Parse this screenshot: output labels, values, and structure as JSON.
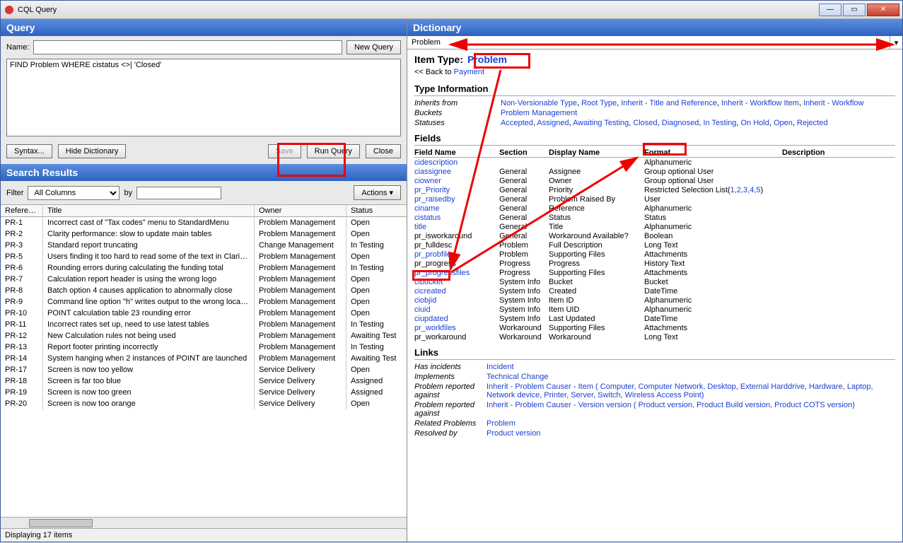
{
  "window": {
    "title": "CQL Query"
  },
  "query": {
    "header": "Query",
    "name_label": "Name:",
    "name_value": "",
    "new_query": "New Query",
    "cql_text": "FIND Problem WHERE cistatus <>| 'Closed'",
    "syntax": "Syntax...",
    "hide_dict": "Hide Dictionary",
    "save": "Save",
    "run": "Run Query",
    "close": "Close"
  },
  "results": {
    "header": "Search Results",
    "filter_label": "Filter",
    "filter_value": "All Columns",
    "by_label": "by",
    "by_value": "",
    "actions": "Actions ▾",
    "cols": {
      "ref": "Reference",
      "title": "Title",
      "owner": "Owner",
      "status": "Status"
    },
    "rows": [
      {
        "ref": "PR-1",
        "title": "Incorrect cast of \"Tax codes\" menu to StandardMenu",
        "owner": "Problem Management",
        "status": "Open"
      },
      {
        "ref": "PR-2",
        "title": "Clarity performance: slow to update main tables",
        "owner": "Problem Management",
        "status": "Open"
      },
      {
        "ref": "PR-3",
        "title": "Standard report truncating",
        "owner": "Change Management",
        "status": "In Testing"
      },
      {
        "ref": "PR-5",
        "title": "Users finding it too hard to read some of the text in Clarity reports",
        "owner": "Problem Management",
        "status": "Open"
      },
      {
        "ref": "PR-6",
        "title": "Rounding errors during calculating the funding total",
        "owner": "Problem Management",
        "status": "In Testing"
      },
      {
        "ref": "PR-7",
        "title": "Calculation report header is using the wrong logo",
        "owner": "Problem Management",
        "status": "Open"
      },
      {
        "ref": "PR-8",
        "title": "Batch option 4 causes application to abnormally close",
        "owner": "Problem Management",
        "status": "Open"
      },
      {
        "ref": "PR-9",
        "title": "Command line option \"h\" writes output to the wrong location",
        "owner": "Problem Management",
        "status": "Open"
      },
      {
        "ref": "PR-10",
        "title": "POINT calculation table 23 rounding error",
        "owner": "Problem Management",
        "status": "Open"
      },
      {
        "ref": "PR-11",
        "title": "Incorrect rates set up, need to use latest tables",
        "owner": "Problem Management",
        "status": "In Testing"
      },
      {
        "ref": "PR-12",
        "title": "New Calculation rules not being used",
        "owner": "Problem Management",
        "status": "Awaiting Test"
      },
      {
        "ref": "PR-13",
        "title": "Report footer printing incorrectly",
        "owner": "Problem Management",
        "status": "In Testing"
      },
      {
        "ref": "PR-14",
        "title": "System hanging when 2 instances of POINT are launched",
        "owner": "Problem Management",
        "status": "Awaiting Test"
      },
      {
        "ref": "PR-17",
        "title": "Screen is now too yellow",
        "owner": "Service Delivery",
        "status": "Open"
      },
      {
        "ref": "PR-18",
        "title": "Screen is far too blue",
        "owner": "Service Delivery",
        "status": "Assigned"
      },
      {
        "ref": "PR-19",
        "title": "Screen is now too green",
        "owner": "Service Delivery",
        "status": "Assigned"
      },
      {
        "ref": "PR-20",
        "title": "Screen is now too orange",
        "owner": "Service Delivery",
        "status": "Open"
      }
    ],
    "status_text": "Displaying 17 items"
  },
  "dictionary": {
    "header": "Dictionary",
    "selector": "Problem",
    "item_type_label": "Item Type:",
    "item_type_value": "Problem",
    "back_prefix": "<< Back to ",
    "back_link": "Payment",
    "type_info_title": "Type Information",
    "inherits_label": "Inherits from",
    "inherits": [
      "Non-Versionable Type",
      "Root Type",
      "Inherit - Title and Reference",
      "Inherit - Workflow Item",
      "Inherit - Workflow"
    ],
    "buckets_label": "Buckets",
    "buckets": [
      "Problem Management"
    ],
    "statuses_label": "Statuses",
    "statuses": [
      "Accepted",
      "Assigned",
      "Awaiting Testing",
      "Closed",
      "Diagnosed",
      "In Testing",
      "On Hold",
      "Open",
      "Rejected"
    ],
    "fields_title": "Fields",
    "fields_cols": {
      "name": "Field Name",
      "section": "Section",
      "display": "Display Name",
      "format": "Format",
      "desc": "Description"
    },
    "fields": [
      {
        "name": "cidescription",
        "link": true,
        "section": "",
        "display": "",
        "format": "Alphanumeric",
        "desc": ""
      },
      {
        "name": "ciassignee",
        "link": true,
        "section": "General",
        "display": "Assignee",
        "format": "Group optional User",
        "desc": ""
      },
      {
        "name": "ciowner",
        "link": true,
        "section": "General",
        "display": "Owner",
        "format": "Group optional User",
        "desc": ""
      },
      {
        "name": "pr_Priority",
        "link": true,
        "section": "General",
        "display": "Priority",
        "format": "Restricted Selection List(1,2,3,4,5)",
        "format_link": "1,2,3,4,5",
        "desc": ""
      },
      {
        "name": "pr_raisedby",
        "link": true,
        "section": "General",
        "display": "Problem Raised By",
        "format": "User",
        "desc": ""
      },
      {
        "name": "ciname",
        "link": true,
        "section": "General",
        "display": "Reference",
        "format": "Alphanumeric",
        "desc": ""
      },
      {
        "name": "cistatus",
        "link": true,
        "section": "General",
        "display": "Status",
        "format": "Status",
        "desc": ""
      },
      {
        "name": "title",
        "link": true,
        "section": "General",
        "display": "Title",
        "format": "Alphanumeric",
        "desc": ""
      },
      {
        "name": "pr_isworkaround",
        "link": false,
        "section": "General",
        "display": "Workaround Available?",
        "format": "Boolean",
        "desc": ""
      },
      {
        "name": "pr_fulldesc",
        "link": false,
        "section": "Problem",
        "display": "Full Description",
        "format": "Long Text",
        "desc": ""
      },
      {
        "name": "pr_probfiles",
        "link": true,
        "section": "Problem",
        "display": "Supporting Files",
        "format": "Attachments",
        "desc": ""
      },
      {
        "name": "pr_progress",
        "link": false,
        "section": "Progress",
        "display": "Progress",
        "format": "History Text",
        "desc": ""
      },
      {
        "name": "pr_progressfiles",
        "link": true,
        "section": "Progress",
        "display": "Supporting Files",
        "format": "Attachments",
        "desc": ""
      },
      {
        "name": "cibucket",
        "link": true,
        "section": "System Info",
        "display": "Bucket",
        "format": "Bucket",
        "desc": ""
      },
      {
        "name": "cicreated",
        "link": true,
        "section": "System Info",
        "display": "Created",
        "format": "DateTime",
        "desc": ""
      },
      {
        "name": "ciobjid",
        "link": true,
        "section": "System Info",
        "display": "Item ID",
        "format": "Alphanumeric",
        "desc": ""
      },
      {
        "name": "ciuid",
        "link": true,
        "section": "System Info",
        "display": "Item UID",
        "format": "Alphanumeric",
        "desc": ""
      },
      {
        "name": "ciupdated",
        "link": true,
        "section": "System Info",
        "display": "Last Updated",
        "format": "DateTime",
        "desc": ""
      },
      {
        "name": "pr_workfiles",
        "link": true,
        "section": "Workaround",
        "display": "Supporting Files",
        "format": "Attachments",
        "desc": ""
      },
      {
        "name": "pr_workaround",
        "link": false,
        "section": "Workaround",
        "display": "Workaround",
        "format": "Long Text",
        "desc": ""
      }
    ],
    "links_title": "Links",
    "links": [
      {
        "label": "Has incidents",
        "val": "Incident"
      },
      {
        "label": "Implements",
        "val": "Technical Change"
      },
      {
        "label": "Problem reported against",
        "val": "Inherit - Problem Causer - Item ( Computer, Computer Network, Desktop, External Harddrive, Hardware, Laptop, Network device, Printer, Server, Switch, Wireless Access Point)"
      },
      {
        "label": "Problem reported against",
        "val": "Inherit - Problem Causer - Version version ( Product version, Product Build version, Product COTS version)"
      },
      {
        "label": "Related Problems",
        "val": "Problem"
      },
      {
        "label": "Resolved by",
        "val": "Product version"
      }
    ]
  }
}
